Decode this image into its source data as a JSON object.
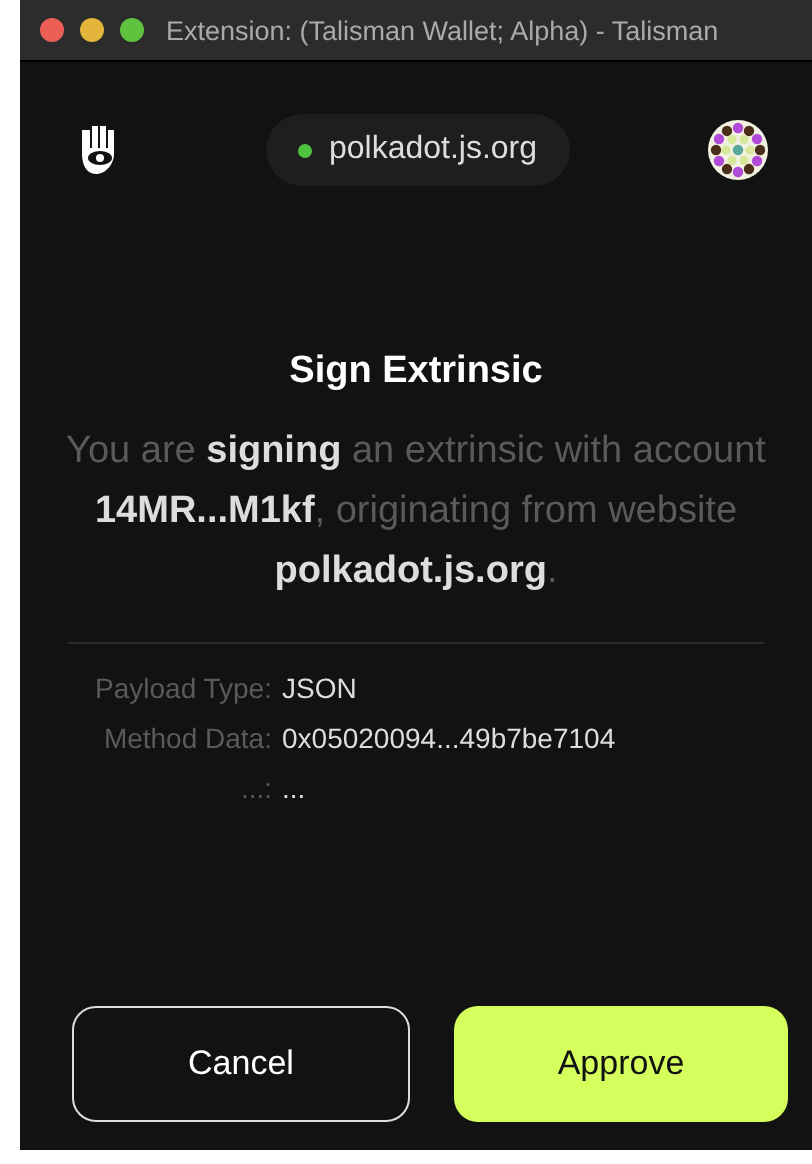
{
  "window": {
    "title": "Extension: (Talisman Wallet; Alpha) - Talisman"
  },
  "site": {
    "label": "polkadot.js.org",
    "connected": true
  },
  "title": "Sign Extrinsic",
  "message": "You are **signing** an extrinsic with account **14MR...M1kf**, originating from website **polkadot.js.org**.",
  "details": [
    {
      "label": "Payload Type:",
      "value": "JSON"
    },
    {
      "label": "Method Data:",
      "value": "0x05020094...49b7be7104"
    },
    {
      "label": "...:",
      "value": "..."
    }
  ],
  "buttons": [
    {
      "label": "Cancel",
      "kind": "secondary"
    },
    {
      "label": "Approve",
      "kind": "primary"
    }
  ]
}
